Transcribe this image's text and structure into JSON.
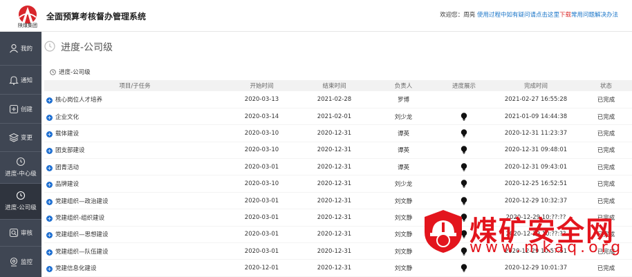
{
  "header": {
    "logo_text": "陕煤集团",
    "title": "全面预算考核督办管理系统",
    "welcome": "欢迎您：周亮",
    "help_prefix": "使用过程中如有疑问请点击这里",
    "help_download": "下载",
    "help_suffix": "常用问题解决办法",
    "brand_color": "#d8262b"
  },
  "sidebar": {
    "items": [
      {
        "label": "我的",
        "icon": "user-icon"
      },
      {
        "label": "通知",
        "icon": "bell-icon"
      },
      {
        "label": "创建",
        "icon": "plus-square-icon"
      },
      {
        "label": "变更",
        "icon": "layers-icon"
      },
      {
        "label": "进度-中心级",
        "icon": "clock-icon"
      },
      {
        "label": "进度-公司级",
        "icon": "clock-icon"
      },
      {
        "label": "审核",
        "icon": "audit-icon"
      },
      {
        "label": "监控",
        "icon": "monitor-icon"
      }
    ],
    "active_index": 5
  },
  "page": {
    "title": "进度-公司级",
    "breadcrumb": "进度-公司级"
  },
  "table": {
    "columns": [
      "项目/子任务",
      "开始时间",
      "结束时间",
      "负责人",
      "进度展示",
      "完成时间",
      "状态"
    ],
    "rows": [
      {
        "task": "核心岗位人才培养",
        "start": "2020-03-13",
        "end": "2021-02-28",
        "owner": "罗博",
        "progress_icon": false,
        "done": "2021-02-27 16:55:28",
        "status": "已完成"
      },
      {
        "task": "企业文化",
        "start": "2020-03-14",
        "end": "2021-02-01",
        "owner": "刘少龙",
        "progress_icon": true,
        "done": "2021-01-09 14:44:38",
        "status": "已完成"
      },
      {
        "task": "载体建设",
        "start": "2020-03-10",
        "end": "2020-12-31",
        "owner": "谭英",
        "progress_icon": true,
        "done": "2020-12-31 11:23:37",
        "status": "已完成"
      },
      {
        "task": "团支部建设",
        "start": "2020-03-10",
        "end": "2020-12-31",
        "owner": "谭英",
        "progress_icon": true,
        "done": "2020-12-31 09:48:01",
        "status": "已完成"
      },
      {
        "task": "团青活动",
        "start": "2020-03-01",
        "end": "2020-12-31",
        "owner": "谭英",
        "progress_icon": true,
        "done": "2020-12-31 09:43:01",
        "status": "已完成"
      },
      {
        "task": "品牌建设",
        "start": "2020-03-10",
        "end": "2020-12-31",
        "owner": "刘少龙",
        "progress_icon": true,
        "done": "2020-12-25 16:52:51",
        "status": "已完成"
      },
      {
        "task": "党建组织—政治建设",
        "start": "2020-03-01",
        "end": "2020-12-31",
        "owner": "刘文静",
        "progress_icon": true,
        "done": "2020-12-29 10:32:37",
        "status": "已完成"
      },
      {
        "task": "党建组织-组织建设",
        "start": "2020-03-01",
        "end": "2020-12-31",
        "owner": "刘文静",
        "progress_icon": true,
        "done": "2020-12-29 10:??:??",
        "status": "已完成"
      },
      {
        "task": "党建组织—思想建设",
        "start": "2020-03-01",
        "end": "2020-12-31",
        "owner": "刘文静",
        "progress_icon": true,
        "done": "2020-12-29 10:??:??",
        "status": "已完成"
      },
      {
        "task": "党建组织—队伍建设",
        "start": "2020-03-01",
        "end": "2020-12-31",
        "owner": "刘文静",
        "progress_icon": true,
        "done": "2020-12-29 10:57:51",
        "status": "已完成"
      },
      {
        "task": "党建信息化建设",
        "start": "2020-12-01",
        "end": "2020-12-31",
        "owner": "刘文静",
        "progress_icon": true,
        "done": "2020-12-29 10:01:37",
        "status": "已完成"
      }
    ]
  },
  "watermark": {
    "text": "煤矿安全网",
    "url": "www.mkaq.org",
    "color": "#e3151d"
  }
}
